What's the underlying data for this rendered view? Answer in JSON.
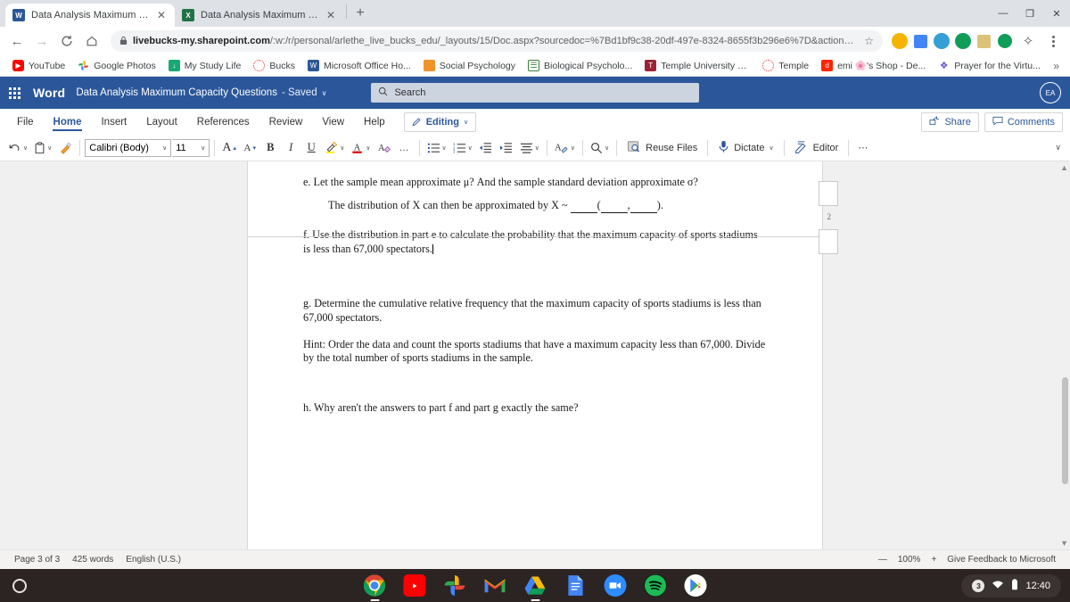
{
  "browser": {
    "tabs": [
      {
        "title": "Data Analysis Maximum Capaci",
        "favicon": "word-icon",
        "active": true
      },
      {
        "title": "Data Analysis Maximum Capaci",
        "favicon": "excel-icon",
        "active": false
      }
    ],
    "new_tab_label": "+",
    "window_controls": {
      "minimize": "—",
      "maximize": "❐",
      "close": "✕"
    },
    "nav": {
      "back": "←",
      "forward": "→",
      "reload": "⟳",
      "home": "⌂"
    },
    "omnibox": {
      "lock": "🔒",
      "url_domain": "livebucks-my.sharepoint.com",
      "url_path": "/:w:/r/personal/arlethe_live_bucks_edu/_layouts/15/Doc.aspx?sourcedoc=%7Bd1bf9c38-20df-497e-8324-8655f3b296e6%7D&action=e...",
      "star": "☆"
    },
    "bookmarks": [
      {
        "label": "YouTube",
        "icon": "youtube-icon"
      },
      {
        "label": "Google Photos",
        "icon": "google-photos-icon"
      },
      {
        "label": "My Study Life",
        "icon": "my-study-life-icon"
      },
      {
        "label": "Bucks",
        "icon": "bucks-icon"
      },
      {
        "label": "Microsoft Office Ho...",
        "icon": "word-icon"
      },
      {
        "label": "Social Psychology",
        "icon": "book-icon"
      },
      {
        "label": "Biological Psycholo...",
        "icon": "document-icon"
      },
      {
        "label": "Temple University P...",
        "icon": "temple-icon"
      },
      {
        "label": "Temple",
        "icon": "temple-circle-icon"
      },
      {
        "label": "emi 🌸's Shop - De...",
        "icon": "depop-icon"
      },
      {
        "label": "Prayer for the Virtu...",
        "icon": "prayer-icon"
      }
    ],
    "bookmarks_overflow": "»"
  },
  "word": {
    "app_name": "Word",
    "doc_title": "Data Analysis Maximum Capacity Questions",
    "save_state": "- Saved",
    "save_caret": "∨",
    "search": {
      "placeholder": "Search",
      "icon": "search-icon"
    },
    "avatar_initials": "EA",
    "ribbon_tabs": [
      {
        "label": "File",
        "active": false
      },
      {
        "label": "Home",
        "active": true
      },
      {
        "label": "Insert",
        "active": false
      },
      {
        "label": "Layout",
        "active": false
      },
      {
        "label": "References",
        "active": false
      },
      {
        "label": "Review",
        "active": false
      },
      {
        "label": "View",
        "active": false
      },
      {
        "label": "Help",
        "active": false
      }
    ],
    "editing_button": {
      "label": "Editing",
      "icon": "pencil-icon",
      "caret": "∨"
    },
    "share_button": {
      "label": "Share",
      "icon": "share-icon"
    },
    "comments_button": {
      "label": "Comments",
      "icon": "comment-icon"
    },
    "toolbar": {
      "undo": {
        "icon": "undo-icon",
        "caret": "∨"
      },
      "paste": {
        "icon": "clipboard-icon",
        "caret": "∨"
      },
      "format_painter": {
        "icon": "format-painter-icon"
      },
      "font_name": "Calibri (Body)",
      "font_size": "11",
      "grow_font": "A",
      "shrink_font": "A",
      "bold": "B",
      "italic": "I",
      "underline": "U",
      "highlight": {
        "icon": "highlight-icon",
        "caret": "∨"
      },
      "font_color": {
        "icon": "font-color-icon",
        "caret": "∨"
      },
      "clear_formatting": {
        "icon": "clear-formatting-icon"
      },
      "more_font": "…",
      "bullets": {
        "icon": "bullet-list-icon",
        "caret": "∨"
      },
      "numbering": {
        "icon": "numbered-list-icon",
        "caret": "∨"
      },
      "decrease_indent": {
        "icon": "decrease-indent-icon"
      },
      "increase_indent": {
        "icon": "increase-indent-icon"
      },
      "align": {
        "icon": "align-icon",
        "caret": "∨"
      },
      "styles": {
        "icon": "styles-icon",
        "caret": "∨"
      },
      "find": {
        "icon": "find-icon",
        "caret": "∨"
      },
      "reuse_files": {
        "label": "Reuse Files",
        "icon": "reuse-files-icon"
      },
      "dictate": {
        "label": "Dictate",
        "icon": "microphone-icon",
        "caret": "∨"
      },
      "editor": {
        "label": "Editor",
        "icon": "editor-icon"
      },
      "more": "⋯",
      "collapse_caret": "∨"
    },
    "document": {
      "margin_note_number": "2",
      "paragraphs": [
        {
          "id": "e",
          "text": "e. Let the sample mean approximate μ? And the sample standard deviation approximate σ?"
        },
        {
          "id": "e2",
          "prefix": "The distribution of X can then be approximated by X ~ ",
          "suffix": ")."
        },
        {
          "id": "f",
          "text": "f. Use the distribution in part e to calculate the probability that the maximum capacity of sports stadiums is less than 67,000 spectators."
        },
        {
          "id": "g",
          "text": "g. Determine the cumulative relative frequency that the maximum capacity of sports stadiums is less than 67,000 spectators."
        },
        {
          "id": "hint",
          "text": "Hint: Order the data and count the sports stadiums that have a maximum capacity less than 67,000. Divide by the total number of sports stadiums in the sample."
        },
        {
          "id": "h",
          "text": "h. Why aren't the answers to part f and part g exactly the same?"
        }
      ]
    },
    "status_bar": {
      "page": "Page 3 of 3",
      "words": "425 words",
      "language": "English (U.S.)",
      "zoom_out": "—",
      "zoom_level": "100%",
      "zoom_in": "+",
      "feedback": "Give Feedback to Microsoft"
    }
  },
  "taskbar": {
    "launcher": "launcher-icon",
    "apps": [
      {
        "name": "chrome-icon",
        "running": true
      },
      {
        "name": "youtube-icon",
        "running": false
      },
      {
        "name": "google-photos-icon",
        "running": false
      },
      {
        "name": "gmail-icon",
        "running": false
      },
      {
        "name": "google-drive-icon",
        "running": true
      },
      {
        "name": "google-docs-icon",
        "running": false
      },
      {
        "name": "zoom-icon",
        "running": false
      },
      {
        "name": "spotify-icon",
        "running": false
      },
      {
        "name": "play-store-icon",
        "running": false
      }
    ],
    "tray": {
      "notification_count": "3",
      "wifi_icon": "wifi-icon",
      "battery_icon": "battery-icon",
      "clock": "12:40"
    }
  },
  "colors": {
    "word_blue": "#2b579a",
    "chrome_tabstrip": "#dee1e6",
    "taskbar": "#2b2423"
  }
}
